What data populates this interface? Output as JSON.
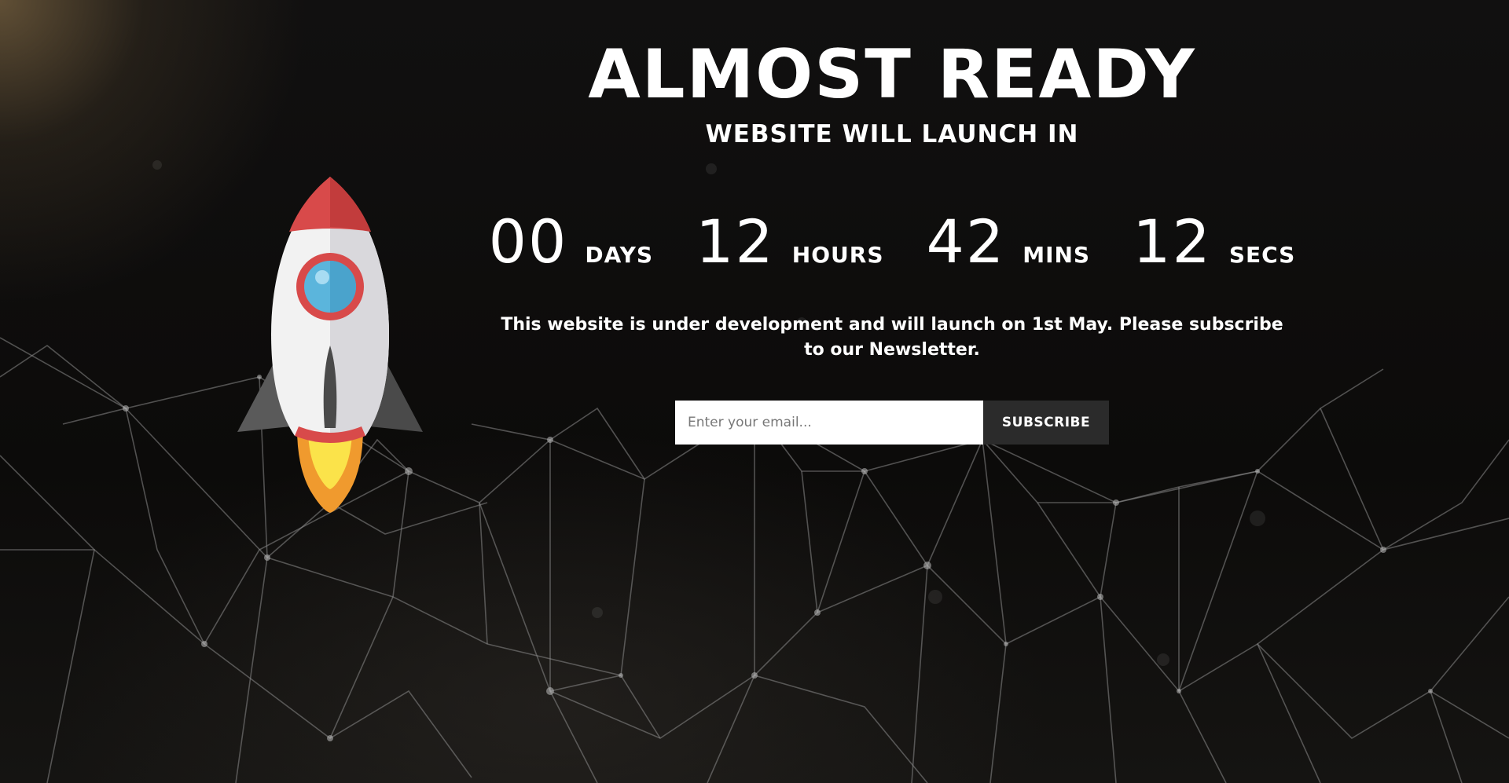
{
  "hero": {
    "title": "ALMOST READY",
    "subtitle": "WEBSITE WILL LAUNCH IN"
  },
  "countdown": {
    "days": {
      "value": "00",
      "label": "DAYS"
    },
    "hours": {
      "value": "12",
      "label": "HOURS"
    },
    "mins": {
      "value": "42",
      "label": "MINS"
    },
    "secs": {
      "value": "12",
      "label": "SECS"
    }
  },
  "message": "This website is under development and will launch on 1st May. Please subscribe to our Newsletter.",
  "subscribe": {
    "placeholder": "Enter your email...",
    "button_label": "SUBSCRIBE"
  },
  "colors": {
    "background": "#0b0a09",
    "text": "#ffffff",
    "button": "#2b2b2b",
    "rocket_red": "#d84a4a",
    "rocket_window": "#5bb5dc",
    "flame_orange": "#f09a2e",
    "flame_yellow": "#fbe34a"
  },
  "icons": [
    "rocket-icon",
    "network-background"
  ]
}
